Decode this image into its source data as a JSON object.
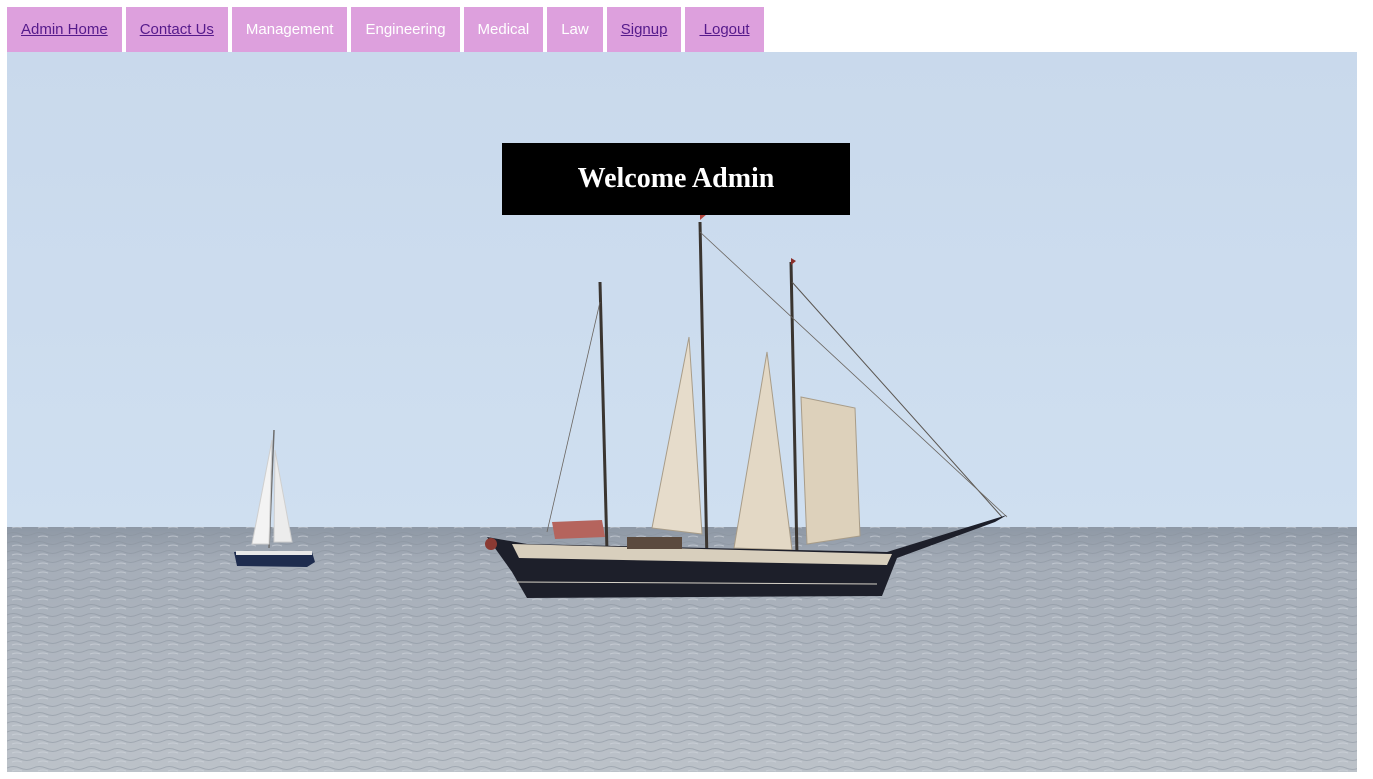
{
  "nav": {
    "items": [
      {
        "label": "Admin Home",
        "style": "link"
      },
      {
        "label": "Contact Us",
        "style": "link"
      },
      {
        "label": "Management",
        "style": "plain"
      },
      {
        "label": "Engineering",
        "style": "plain"
      },
      {
        "label": "Medical",
        "style": "plain"
      },
      {
        "label": "Law",
        "style": "plain"
      },
      {
        "label": "Signup",
        "style": "link"
      },
      {
        "label": " Logout",
        "style": "link"
      }
    ]
  },
  "hero": {
    "title": "Welcome Admin"
  },
  "colors": {
    "nav_bg": "#dda0dd",
    "link_text": "#551a8b",
    "plain_text": "#ffffff",
    "banner_bg": "#000000"
  }
}
